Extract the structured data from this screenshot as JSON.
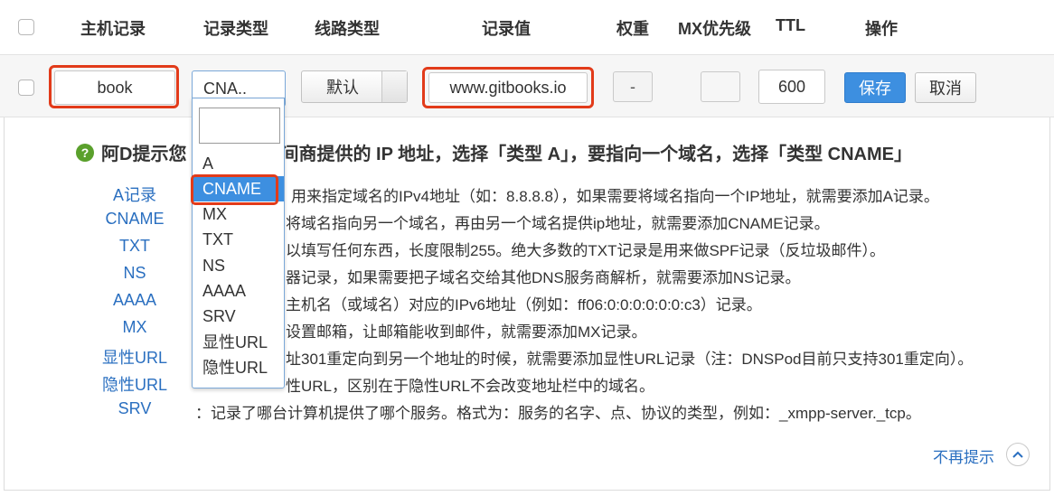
{
  "header": {
    "col_host": "主机记录",
    "col_type": "记录类型",
    "col_line": "线路类型",
    "col_value": "记录值",
    "col_weight": "权重",
    "col_mx": "MX优先级",
    "col_ttl": "TTL",
    "col_action": "操作"
  },
  "edit_row": {
    "host": "book",
    "type_selected": "CNA..",
    "line": "默认",
    "value": "www.gitbooks.io",
    "weight": "-",
    "mx": "",
    "ttl": "600",
    "save_label": "保存",
    "cancel_label": "取消"
  },
  "dropdown": {
    "search_value": "",
    "options": [
      "A",
      "CNAME",
      "MX",
      "TXT",
      "NS",
      "AAAA",
      "SRV",
      "显性URL",
      "隐性URL"
    ],
    "selected_index": 1
  },
  "tip": {
    "title_part1": "阿D提示您",
    "title_part2": "间商提供的 IP 地址，选择「类型 A」，要指向一个域名，选择「类型 CNAME」",
    "records": [
      {
        "name": "A记录",
        "desc": "用来指定域名的IPv4地址（如：8.8.8.8），如果需要将域名指向一个IP地址，就需要添加A记录。"
      },
      {
        "name": "CNAME",
        "desc": "将域名指向另一个域名，再由另一个域名提供ip地址，就需要添加CNAME记录。"
      },
      {
        "name": "TXT",
        "desc": "以填写任何东西，长度限制255。绝大多数的TXT记录是用来做SPF记录（反垃圾邮件）。"
      },
      {
        "name": "NS",
        "desc": "器记录，如果需要把子域名交给其他DNS服务商解析，就需要添加NS记录。"
      },
      {
        "name": "AAAA",
        "desc": "主机名（或域名）对应的IPv6地址（例如：ff06:0:0:0:0:0:0:c3）记录。"
      },
      {
        "name": "MX",
        "desc": "设置邮箱，让邮箱能收到邮件，就需要添加MX记录。"
      },
      {
        "name": "显性URL",
        "desc": "址301重定向到另一个地址的时候，就需要添加显性URL记录（注：DNSPod目前只支持301重定向）。"
      },
      {
        "name": "隐性URL",
        "desc": "性URL，区别在于隐性URL不会改变地址栏中的域名。"
      },
      {
        "name": "SRV",
        "desc": "：记录了哪台计算机提供了哪个服务。格式为：服务的名字、点、协议的类型，例如：_xmpp-server._tcp。"
      }
    ],
    "no_more_label": "不再提示"
  },
  "colors": {
    "accent_blue": "#3d8fe0",
    "link_blue": "#2a6fc0",
    "highlight_red": "#e23b1a",
    "tip_green": "#5aa02c"
  }
}
